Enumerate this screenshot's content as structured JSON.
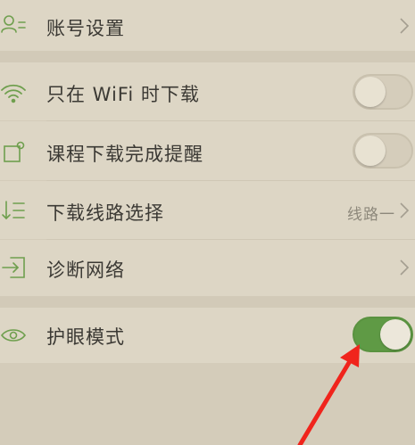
{
  "settings": {
    "account": {
      "label": "账号设置",
      "icon": "person-list-icon"
    },
    "wifi_only": {
      "label": "只在 WiFi 时下载",
      "icon": "wifi-icon",
      "enabled": false
    },
    "download_reminder": {
      "label": "课程下载完成提醒",
      "icon": "notification-icon",
      "enabled": false
    },
    "download_route": {
      "label": "下载线路选择",
      "value": "线路一",
      "icon": "download-list-icon"
    },
    "network_diag": {
      "label": "诊断网络",
      "icon": "enter-icon"
    },
    "eye_care": {
      "label": "护眼模式",
      "icon": "eye-icon",
      "enabled": true
    }
  },
  "colors": {
    "accent": "#6f9f4e",
    "toggle_on": "#5f9a45",
    "annotation_arrow": "#f0241c",
    "background": "#d4ccba",
    "row_background": "#ddd6c5"
  }
}
